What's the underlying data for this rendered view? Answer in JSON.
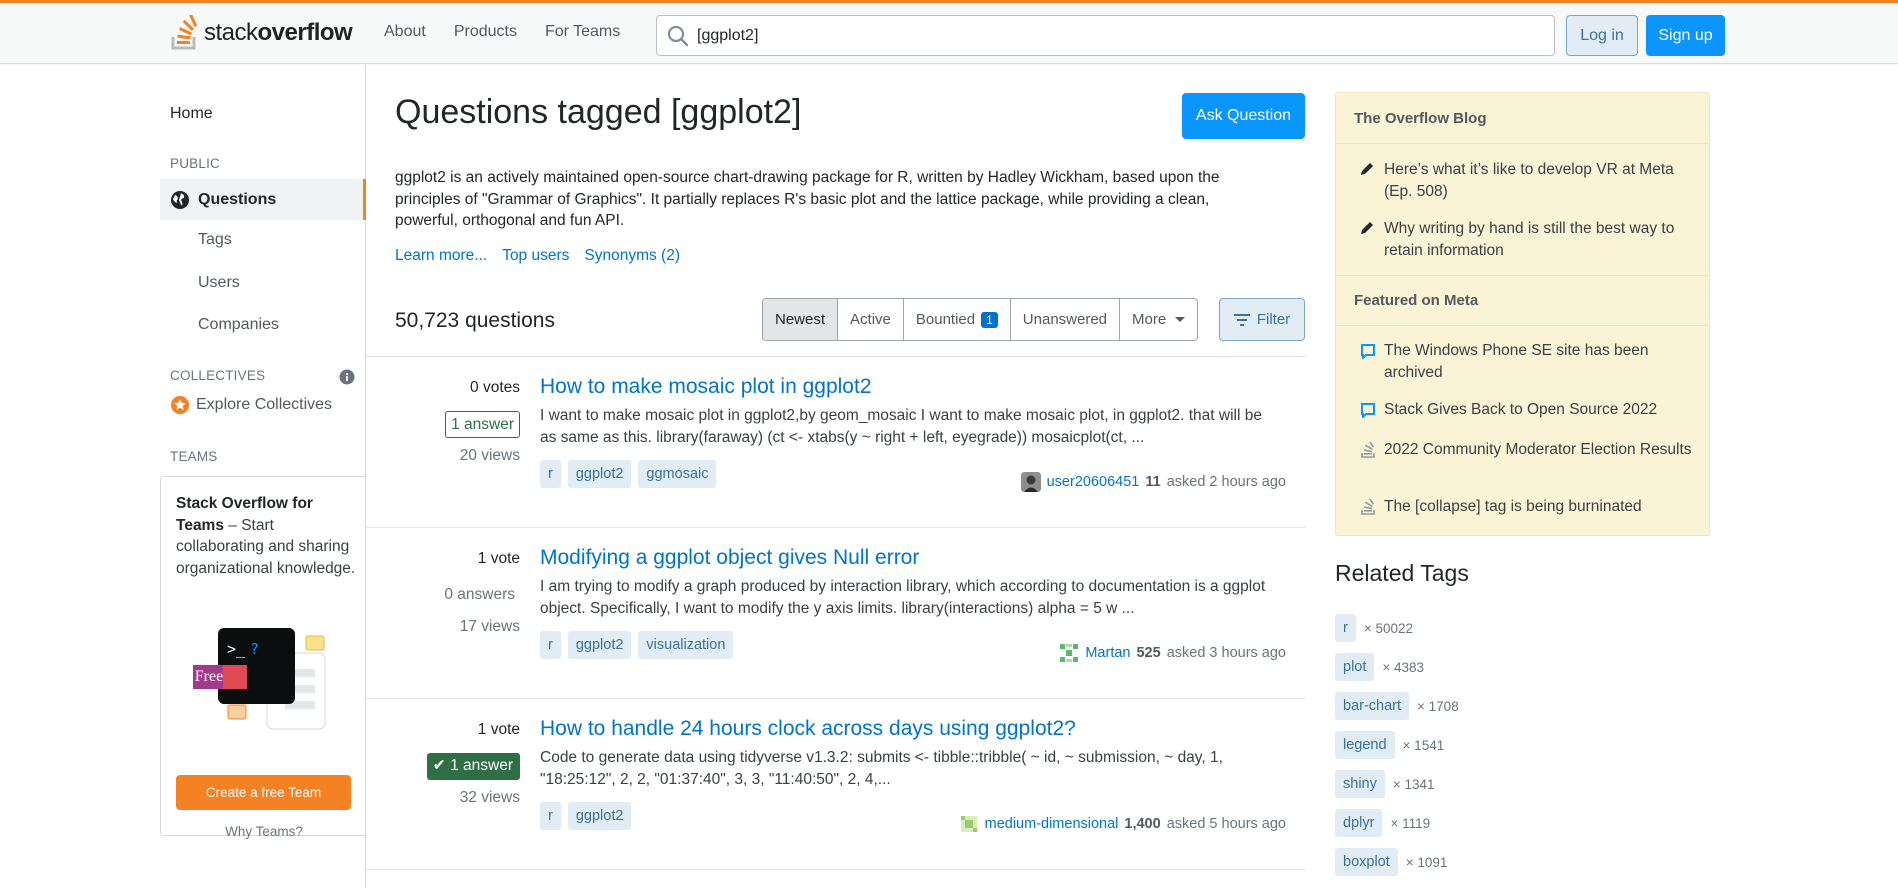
{
  "header": {
    "logo_text_light": "stack",
    "logo_text_bold": "overflow",
    "nav": [
      "About",
      "Products",
      "For Teams"
    ],
    "search_value": "[ggplot2]",
    "login_label": "Log in",
    "signup_label": "Sign up"
  },
  "sidebar": {
    "home": "Home",
    "public_label": "PUBLIC",
    "questions": "Questions",
    "tags": "Tags",
    "users": "Users",
    "companies": "Companies",
    "collectives_label": "COLLECTIVES",
    "explore_collectives": "Explore Collectives",
    "teams_label": "TEAMS",
    "teams_title": "Stack Overflow for Teams",
    "teams_text": " – Start collaborating and sharing organizational knowledge.",
    "free_badge": "Free",
    "create_team": "Create a free Team",
    "why_teams": "Why Teams?"
  },
  "main": {
    "title": "Questions tagged [ggplot2]",
    "ask_button": "Ask Question",
    "description": "ggplot2 is an actively maintained open-source chart-drawing package for R, written by Hadley Wickham, based upon the principles of \"Grammar of Graphics\". It partially replaces R's basic plot and the lattice package, while providing a clean, powerful, orthogonal and fun API.",
    "links": [
      "Learn more...",
      "Top users",
      "Synonyms (2)"
    ],
    "count": "50,723 questions",
    "filters": {
      "newest": "Newest",
      "active": "Active",
      "bountied": "Bountied",
      "bountied_count": "1",
      "unanswered": "Unanswered",
      "more": "More"
    },
    "filter_button": "Filter",
    "questions": [
      {
        "votes": "0 votes",
        "answers": "1 answer",
        "views": "20 views",
        "title": "How to make mosaic plot in ggplot2",
        "excerpt": "I want to make mosaic plot in ggplot2,by geom_mosaic I want to make mosaic plot, in ggplot2. that will be as same as this. library(faraway) (ct <- xtabs(y ~ right + left, eyegrade)) mosaicplot(ct, ...",
        "tags": [
          "r",
          "ggplot2",
          "ggmosaic"
        ],
        "user": "user20606451",
        "rep": "11",
        "asked": "asked 2 hours ago"
      },
      {
        "votes": "1 vote",
        "answers": "0 answers",
        "views": "17 views",
        "title": "Modifying a ggplot object gives Null error",
        "excerpt": "I am trying to modify a graph produced by interaction library, which according to documentation is a ggplot object. Specifically, I want to modify the y axis limits. library(interactions) alpha = 5 w ...",
        "tags": [
          "r",
          "ggplot2",
          "visualization"
        ],
        "user": "Martan",
        "rep": "525",
        "asked": "asked 3 hours ago"
      },
      {
        "votes": "1 vote",
        "answers": "1 answer",
        "views": "32 views",
        "title": "How to handle 24 hours clock across days using ggplot2?",
        "excerpt": "Code to generate data using tidyverse v1.3.2: submits <- tibble::tribble( ~ id, ~ submission, ~ day, 1, \"18:25:12\", 2, 2, \"01:37:40\", 3, 3, \"11:40:50\", 2, 4,...",
        "tags": [
          "r",
          "ggplot2"
        ],
        "user": "medium-dimensional",
        "rep": "1,400",
        "asked": "asked 5 hours ago"
      }
    ]
  },
  "right": {
    "blog_title": "The Overflow Blog",
    "blog_items": [
      "Here’s what it’s like to develop VR at Meta (Ep. 508)",
      "Why writing by hand is still the best way to retain information"
    ],
    "meta_title": "Featured on Meta",
    "meta_items": [
      "The Windows Phone SE site has been archived",
      "Stack Gives Back to Open Source 2022",
      "2022 Community Moderator Election Results",
      "The [collapse] tag is being burninated"
    ],
    "related_title": "Related Tags",
    "related_tags": [
      {
        "name": "r",
        "count": "× 50022"
      },
      {
        "name": "plot",
        "count": "× 4383"
      },
      {
        "name": "bar-chart",
        "count": "× 1708"
      },
      {
        "name": "legend",
        "count": "× 1541"
      },
      {
        "name": "shiny",
        "count": "× 1341"
      },
      {
        "name": "dplyr",
        "count": "× 1119"
      },
      {
        "name": "boxplot",
        "count": "× 1091"
      }
    ]
  },
  "colors": {
    "accent_orange": "#f48225",
    "link_blue": "#0074cc",
    "button_blue": "#0a95ff",
    "accepted_green": "#2f6f44",
    "blog_bg": "#fbf3d5"
  }
}
